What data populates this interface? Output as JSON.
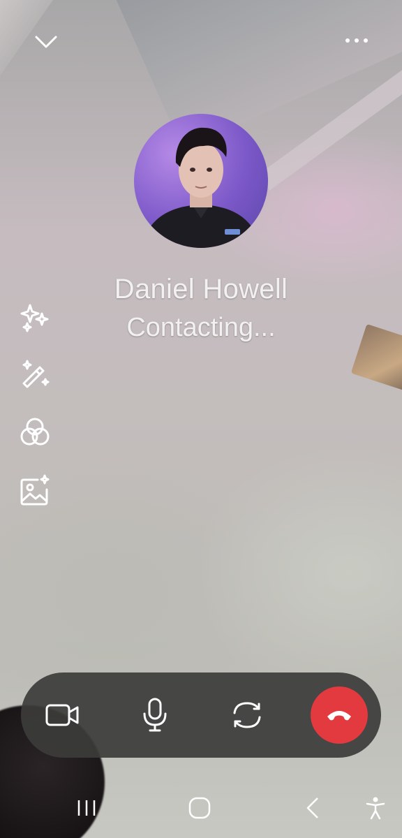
{
  "contact": {
    "name": "Daniel Howell",
    "status": "Contacting..."
  },
  "top_bar": {
    "minimize_icon": "chevron-down-icon",
    "more_icon": "more-options-icon"
  },
  "side_tools": [
    {
      "icon": "sparkles-icon"
    },
    {
      "icon": "magic-wand-icon"
    },
    {
      "icon": "color-filter-icon"
    },
    {
      "icon": "background-effect-icon"
    }
  ],
  "call_controls": [
    {
      "icon": "video-camera-icon"
    },
    {
      "icon": "microphone-icon"
    },
    {
      "icon": "switch-camera-icon"
    },
    {
      "icon": "end-call-icon",
      "color": "#e23a3f"
    }
  ],
  "nav_bar": [
    {
      "icon": "recent-apps-icon"
    },
    {
      "icon": "home-icon"
    },
    {
      "icon": "back-icon"
    },
    {
      "icon": "accessibility-icon"
    }
  ]
}
